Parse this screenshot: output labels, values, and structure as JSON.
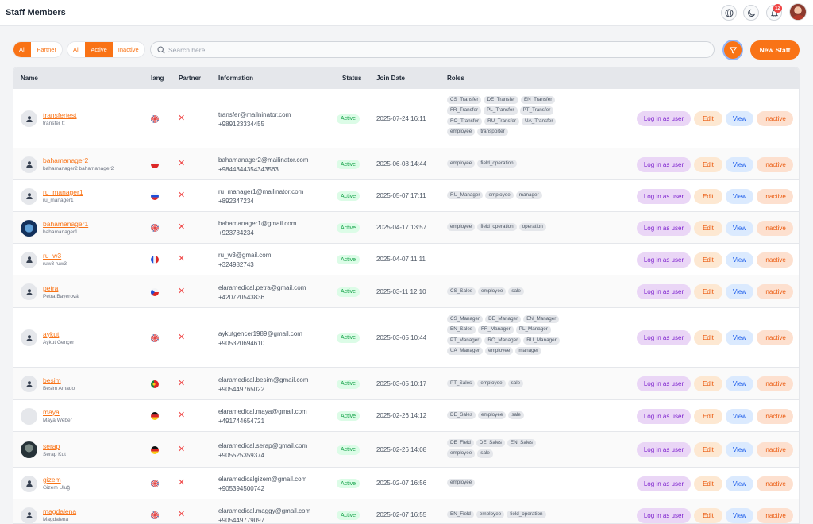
{
  "page": {
    "title": "Staff Members"
  },
  "header_icons": {
    "notification_count": "12"
  },
  "filters": {
    "type_tabs": [
      {
        "label": "All",
        "active": true
      },
      {
        "label": "Partner",
        "active": false
      }
    ],
    "status_tabs": [
      {
        "label": "All",
        "active": false
      },
      {
        "label": "Active",
        "active": true
      },
      {
        "label": "Inactive",
        "active": false
      }
    ]
  },
  "search": {
    "placeholder": "Search here...",
    "value": ""
  },
  "actions": {
    "new_staff": "New Staff"
  },
  "columns": {
    "name": "Name",
    "lang": "lang",
    "partner": "Partner",
    "information": "Information",
    "status": "Status",
    "join_date": "Join Date",
    "roles": "Roles"
  },
  "row_buttons": {
    "login": "Log in as user",
    "edit": "Edit",
    "view": "View",
    "inactive": "Inactive"
  },
  "rows": [
    {
      "username": "transfertest",
      "fullname": "transfer tt",
      "flag": "uk",
      "avatar": "default",
      "email": "transfer@mailninator.com",
      "phone": "+989123334455",
      "status": "Active",
      "join_date": "2025-07-24 16:11",
      "roles": [
        "CS_Transfer",
        "DE_Transfer",
        "EN_Transfer",
        "FR_Transfer",
        "PL_Transfer",
        "PT_Transfer",
        "RO_Transfer",
        "RU_Transfer",
        "UA_Transfer",
        "employee",
        "transporter"
      ]
    },
    {
      "username": "bahamanager2",
      "fullname": "bahamanager2 bahamanager2",
      "flag": "pl",
      "avatar": "default",
      "email": "bahamanager2@mailinator.com",
      "phone": "+9844344354343563",
      "status": "Active",
      "join_date": "2025-06-08 14:44",
      "roles": [
        "employee",
        "field_operation"
      ]
    },
    {
      "username": "ru_manager1",
      "fullname": "ru_manager1",
      "flag": "ru",
      "avatar": "default",
      "email": "ru_manager1@mailinator.com",
      "phone": "+892347234",
      "status": "Active",
      "join_date": "2025-05-07 17:11",
      "roles": [
        "RU_Manager",
        "employee",
        "manager"
      ]
    },
    {
      "username": "bahamanager1",
      "fullname": "bahamanager1",
      "flag": "uk",
      "avatar": "globe",
      "email": "bahamanager1@gmail.com",
      "phone": "+923784234",
      "status": "Active",
      "join_date": "2025-04-17 13:57",
      "roles": [
        "employee",
        "field_operation",
        "operation"
      ]
    },
    {
      "username": "ru_w3",
      "fullname": "ruw3 ruw3",
      "flag": "fr",
      "avatar": "default",
      "email": "ru_w3@gmail.com",
      "phone": "+324982743",
      "status": "Active",
      "join_date": "2025-04-07 11:11",
      "roles": []
    },
    {
      "username": "petra",
      "fullname": "Petra Bayerová",
      "flag": "cz",
      "avatar": "default",
      "email": "elaramedical.petra@gmail.com",
      "phone": "+420720543836",
      "status": "Active",
      "join_date": "2025-03-11 12:10",
      "roles": [
        "CS_Sales",
        "employee",
        "sale"
      ]
    },
    {
      "username": "aykut",
      "fullname": "Aykut Gençer",
      "flag": "uk",
      "avatar": "default",
      "email": "aykutgencer1989@gmail.com",
      "phone": "+905320694610",
      "status": "Active",
      "join_date": "2025-03-05 10:44",
      "roles": [
        "CS_Manager",
        "DE_Manager",
        "EN_Manager",
        "EN_Sales",
        "FR_Manager",
        "PL_Manager",
        "PT_Manager",
        "RO_Manager",
        "RU_Manager",
        "UA_Manager",
        "employee",
        "manager"
      ]
    },
    {
      "username": "besim",
      "fullname": "Besim Amado",
      "flag": "pt",
      "avatar": "default",
      "email": "elaramedical.besim@gmail.com",
      "phone": "+905449765022",
      "status": "Active",
      "join_date": "2025-03-05 10:17",
      "roles": [
        "PT_Sales",
        "employee",
        "sale"
      ]
    },
    {
      "username": "maya",
      "fullname": "Maya Weber",
      "flag": "de",
      "avatar": "blank",
      "email": "elaramedical.maya@gmail.com",
      "phone": "+491744654721",
      "status": "Active",
      "join_date": "2025-02-26 14:12",
      "roles": [
        "DE_Sales",
        "employee",
        "sale"
      ]
    },
    {
      "username": "serap",
      "fullname": "Serap Kut",
      "flag": "de",
      "avatar": "photo",
      "email": "elaramedical.serap@gmail.com",
      "phone": "+905525359374",
      "status": "Active",
      "join_date": "2025-02-26 14:08",
      "roles": [
        "DE_Field",
        "DE_Sales",
        "EN_Sales",
        "employee",
        "sale"
      ]
    },
    {
      "username": "gizem",
      "fullname": "Gizem Uluğ",
      "flag": "uk",
      "avatar": "default",
      "email": "elaramedicalgizem@gmail.com",
      "phone": "+905394500742",
      "status": "Active",
      "join_date": "2025-02-07 16:56",
      "roles": [
        "employee"
      ]
    },
    {
      "username": "magdalena",
      "fullname": "Magdalena",
      "flag": "uk",
      "avatar": "default",
      "email": "elaramedical.maggy@gmail.com",
      "phone": "+905449779097",
      "status": "Active",
      "join_date": "2025-02-07 16:55",
      "roles": [
        "EN_Field",
        "employee",
        "field_operation"
      ]
    }
  ]
}
